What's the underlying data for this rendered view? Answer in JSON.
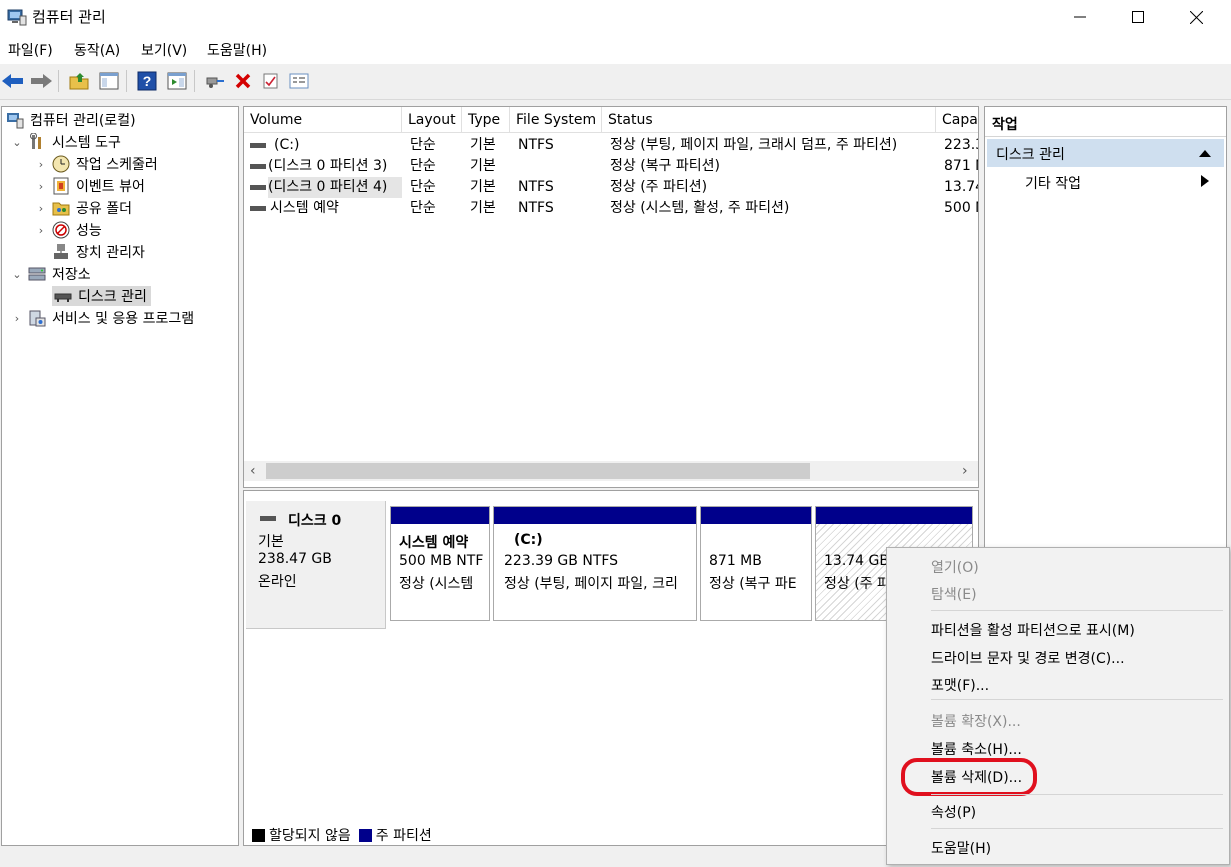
{
  "window": {
    "title": "컴퓨터 관리"
  },
  "menu": [
    "파일(F)",
    "동작(A)",
    "보기(V)",
    "도움말(H)"
  ],
  "toolbar": {
    "icons": [
      "back-icon",
      "forward-icon",
      "up-folder-icon",
      "show-tree-icon",
      "help-icon",
      "show-actions-icon",
      "connect-icon",
      "delete-icon",
      "checklist-icon",
      "properties-icon"
    ],
    "accent_blue": "#1f5fbf",
    "delete_red": "#d40000"
  },
  "tree": {
    "items": [
      {
        "label": "컴퓨터 관리(로컬)",
        "icon": "computer-icon"
      },
      {
        "label": "시스템 도구",
        "icon": "tools-icon"
      },
      {
        "label": "작업 스케줄러",
        "icon": "clock-icon"
      },
      {
        "label": "이벤트 뷰어",
        "icon": "event-viewer-icon"
      },
      {
        "label": "공유 폴더",
        "icon": "shared-folder-icon"
      },
      {
        "label": "성능",
        "icon": "performance-icon"
      },
      {
        "label": "장치 관리자",
        "icon": "device-manager-icon"
      },
      {
        "label": "저장소",
        "icon": "storage-icon"
      },
      {
        "label": "디스크 관리",
        "icon": "disk-icon"
      },
      {
        "label": "서비스 및 응용 프로그램",
        "icon": "services-icon"
      }
    ]
  },
  "volumes": {
    "columns": [
      "Volume",
      "Layout",
      "Type",
      "File System",
      "Status",
      "Capa"
    ],
    "rows": [
      [
        "(C:)",
        "단순",
        "기본",
        "NTFS",
        "정상 (부팅, 페이지 파일, 크래시 덤프, 주 파티션)",
        "223.3"
      ],
      [
        "(디스크 0 파티션 3)",
        "단순",
        "기본",
        "",
        "정상 (복구 파티션)",
        "871 N"
      ],
      [
        "(디스크 0 파티션 4)",
        "단순",
        "기본",
        "NTFS",
        "정상 (주 파티션)",
        "13.74"
      ],
      [
        "시스템 예약",
        "단순",
        "기본",
        "NTFS",
        "정상 (시스템, 활성, 주 파티션)",
        "500 N"
      ]
    ],
    "scroll_left": "‹",
    "scroll_right": "›"
  },
  "disk": {
    "name": "디스크 0",
    "type": "기본",
    "size": "238.47 GB",
    "state": "온라인",
    "partitions": [
      {
        "name": "시스템 예약",
        "size": "500 MB NTF",
        "status": "정상 (시스템"
      },
      {
        "name": "(C:)",
        "size": "223.39 GB NTFS",
        "status": "정상 (부팅, 페이지 파일, 크리"
      },
      {
        "name": "",
        "size": "871 MB",
        "status": "정상 (복구 파E"
      },
      {
        "name": "",
        "size": "13.74 GB",
        "status": "정상 (주 파"
      }
    ],
    "partition_color": "#00008b"
  },
  "legend": [
    {
      "label": "할당되지 않음",
      "color": "#000000"
    },
    {
      "label": "주 파티션",
      "color": "#00008b"
    }
  ],
  "actions": {
    "header": "작업",
    "section": "디스크 관리",
    "item": "기타 작업",
    "section_bg": "#cfdfef"
  },
  "context_menu": {
    "items": [
      {
        "label": "열기(O)",
        "enabled": false
      },
      {
        "label": "탐색(E)",
        "enabled": false
      },
      {
        "label": "파티션을 활성 파티션으로 표시(M)",
        "enabled": true
      },
      {
        "label": "드라이브 문자 및 경로 변경(C)...",
        "enabled": true
      },
      {
        "label": "포맷(F)...",
        "enabled": true
      },
      {
        "label": "볼륨 확장(X)...",
        "enabled": false
      },
      {
        "label": "볼륨 축소(H)...",
        "enabled": true
      },
      {
        "label": "볼륨 삭제(D)...",
        "enabled": true,
        "highlighted": true
      },
      {
        "label": "속성(P)",
        "enabled": true
      },
      {
        "label": "도움말(H)",
        "enabled": true
      }
    ],
    "highlight_color": "#e0101e"
  }
}
